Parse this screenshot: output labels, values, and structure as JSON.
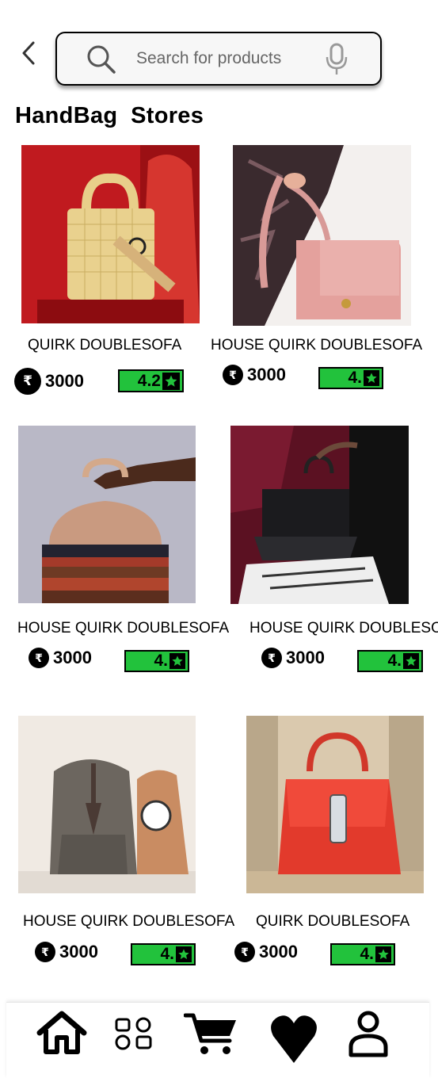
{
  "header": {
    "search": {
      "placeholder": "Search for products"
    }
  },
  "page": {
    "title": "HandBag  Stores"
  },
  "products": [
    {
      "name": "QUIRK DOUBLESOFA",
      "price": "3000",
      "rating": "4.2"
    },
    {
      "name": "HOUSE  QUIRK DOUBLESOFA",
      "price": "3000",
      "rating": "4."
    },
    {
      "name": "HOUSE  QUIRK DOUBLESOFA",
      "price": "3000",
      "rating": "4."
    },
    {
      "name": "HOUSE  QUIRK DOUBLESOFA",
      "price": "3000",
      "rating": "4."
    },
    {
      "name": "HOUSE  QUIRK DOUBLESOFA",
      "price": "3000",
      "rating": "4."
    },
    {
      "name": "QUIRK DOUBLESOFA",
      "price": "3000",
      "rating": "4."
    }
  ],
  "currency_symbol": "₹",
  "colors": {
    "rating_bg": "#22c23c",
    "accent": "#000000"
  },
  "icons": [
    "back-arrow-icon",
    "search-icon",
    "mic-icon",
    "rupee-icon",
    "star-icon",
    "home-icon",
    "categories-icon",
    "cart-icon",
    "heart-icon",
    "profile-icon"
  ]
}
